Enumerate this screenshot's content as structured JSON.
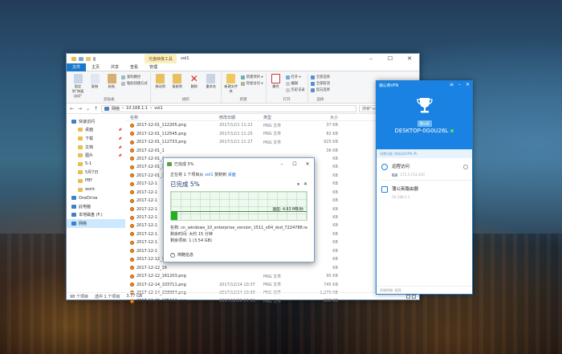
{
  "explorer": {
    "context_tab": "光盘映像工具",
    "title": "vol1",
    "ribbon_tabs": [
      "文件",
      "主页",
      "共享",
      "查看",
      "管理"
    ],
    "groups": [
      {
        "label": "剪贴板",
        "big": [
          "固定到\"快速访问\"",
          "复制",
          "粘贴"
        ],
        "small": [
          "复制路径",
          "粘贴快捷方式"
        ]
      },
      {
        "label": "组织",
        "big": [
          "移动到",
          "复制到",
          "删除",
          "重命名"
        ],
        "small": []
      },
      {
        "label": "新建",
        "big": [
          "新建文件夹"
        ],
        "small": [
          "新建项目 ▾",
          "轻松访问 ▾"
        ]
      },
      {
        "label": "打开",
        "big": [
          "属性"
        ],
        "small": [
          "打开 ▾",
          "编辑",
          "历史记录"
        ]
      },
      {
        "label": "选择",
        "big": [],
        "small": [
          "全部选择",
          "全部取消",
          "反向选择"
        ]
      }
    ],
    "address_parts": [
      "网络",
      "10.168.1.1",
      "vol1"
    ],
    "search_placeholder": "搜索\"vol1\"",
    "nav": [
      {
        "label": "快速访问",
        "type": "top",
        "pin": false
      },
      {
        "label": "桌面",
        "type": "sub",
        "pin": true
      },
      {
        "label": "下载",
        "type": "sub",
        "pin": true
      },
      {
        "label": "文档",
        "type": "sub",
        "pin": true
      },
      {
        "label": "图片",
        "type": "sub",
        "pin": true
      },
      {
        "label": "5-1",
        "type": "sub",
        "pin": false
      },
      {
        "label": "5月7日",
        "type": "sub",
        "pin": false
      },
      {
        "label": "PBY",
        "type": "sub",
        "pin": false
      },
      {
        "label": "work",
        "type": "sub",
        "pin": false
      },
      {
        "label": "OneDrive",
        "type": "top",
        "pin": false
      },
      {
        "label": "此电脑",
        "type": "top",
        "pin": false
      },
      {
        "label": "本地磁盘 (F:)",
        "type": "top",
        "pin": false
      },
      {
        "label": "网络",
        "type": "sel",
        "pin": false
      }
    ],
    "columns": [
      "名称",
      "修改日期",
      "类型",
      "大小"
    ],
    "files": [
      {
        "name": "2017-12-01_112205.png",
        "date": "2017/12/1 11:22",
        "type": "PNG 文件",
        "size": "37 KB"
      },
      {
        "name": "2017-12-01_112545.png",
        "date": "2017/12/1 11:25",
        "type": "PNG 文件",
        "size": "82 KB"
      },
      {
        "name": "2017-12-01_112733.png",
        "date": "2017/12/1 11:27",
        "type": "PNG 文件",
        "size": "925 KB"
      },
      {
        "name": "2017-12-01_1",
        "date": "",
        "type": "",
        "size": "36 KB"
      },
      {
        "name": "2017-12-01_1",
        "date": "",
        "type": "",
        "size": "KB"
      },
      {
        "name": "2017-12-01_1",
        "date": "",
        "type": "",
        "size": "KB"
      },
      {
        "name": "2017-12-01_1",
        "date": "",
        "type": "",
        "size": "KB"
      },
      {
        "name": "2017-12-1",
        "date": "",
        "type": "",
        "size": "KB"
      },
      {
        "name": "2017-12-1",
        "date": "",
        "type": "",
        "size": "KB"
      },
      {
        "name": "2017-12-1",
        "date": "",
        "type": "",
        "size": "KB"
      },
      {
        "name": "2017-12-1",
        "date": "",
        "type": "",
        "size": "KB"
      },
      {
        "name": "2017-12-1",
        "date": "",
        "type": "",
        "size": "KB"
      },
      {
        "name": "2017-12-1",
        "date": "",
        "type": "",
        "size": "KB"
      },
      {
        "name": "2017-12-1",
        "date": "",
        "type": "",
        "size": "KB"
      },
      {
        "name": "2017-12-1",
        "date": "",
        "type": "",
        "size": "KB"
      },
      {
        "name": "2017-12-1",
        "date": "",
        "type": "",
        "size": "KB"
      },
      {
        "name": "2017-12-12_1",
        "date": "",
        "type": "",
        "size": "KB"
      },
      {
        "name": "2017-12-12_16",
        "date": "",
        "type": "",
        "size": "KB"
      },
      {
        "name": "2017-12-12_161203.png",
        "date": "",
        "type": "PNG 文件",
        "size": "95 KB"
      },
      {
        "name": "2017-12-14_103711.png",
        "date": "2017/12/14 10:37",
        "type": "PNG 文件",
        "size": "745 KB"
      },
      {
        "name": "2017-12-14_103904.png",
        "date": "2017/12/14 10:39",
        "type": "PNG 文件",
        "size": "1,270 KB"
      },
      {
        "name": "2017-12-26_175112.png",
        "date": "2017/12/26 17:51",
        "type": "PNG 文件",
        "size": "608 KB"
      }
    ],
    "status": {
      "count": "98 个项目",
      "selected": "选中 1 个项目",
      "size": "3.77 GB"
    }
  },
  "copy_dialog": {
    "title": "已完成 5%",
    "line1_pre": "正在将 1 个项目从",
    "line1_src": "vol1",
    "line1_mid": "复制到",
    "line1_dst": "桌面",
    "percent_text": "已完成 5%",
    "speed": "速度: 4.63 MB/秒",
    "progress": 0.05,
    "name_line": "名称: cn_windows_10_enterprise_version_1511_x64_dvd_7224788.iso",
    "time_line": "剩余时间: 大约 15 分钟",
    "items_line": "剩余项目: 1 (3.54 GB)",
    "more": "简略信息"
  },
  "vpn": {
    "title": "蒲公英VPN",
    "badge": "蒲公英",
    "hostname": "DESKTOP-0G0U26L",
    "note": "如需设备 (和私网/VPN IP)",
    "items": [
      {
        "name": "远程访问",
        "sub_tag": "IP",
        "sub": "172.3.153.220"
      },
      {
        "name": "蒲公英路由器",
        "sub_tag": "",
        "sub": "10.168.1.1"
      }
    ],
    "footer": "局域网络: 组网"
  },
  "colors": {
    "accent": "#1a82e2",
    "ribbon_file": "#1979ca",
    "progress": "#1fb11f"
  }
}
